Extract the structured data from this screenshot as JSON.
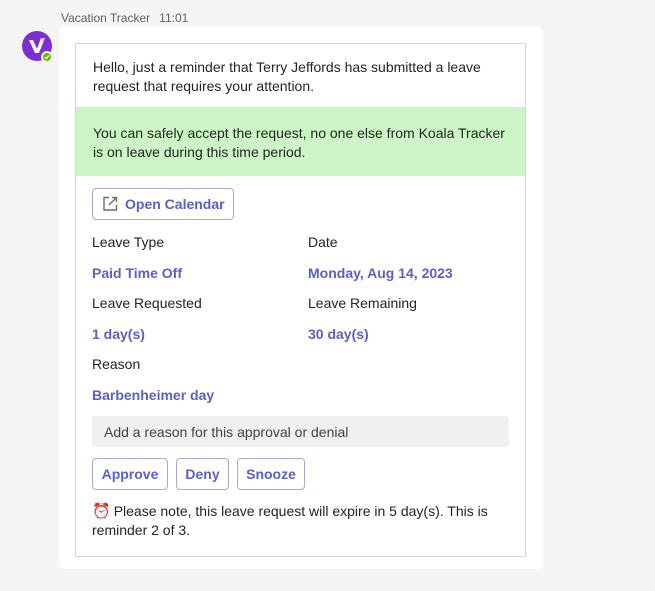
{
  "message": {
    "sender": "Vacation Tracker",
    "time": "11:01"
  },
  "card": {
    "intro": "Hello, just a reminder that Terry Jeffords has submitted a leave request that requires your attention.",
    "banner": "You can safely accept the request, no one else from Koala Tracker is on leave during this time period.",
    "open_calendar_label": "Open Calendar",
    "fields": {
      "leave_type_label": "Leave Type",
      "leave_type_value": "Paid Time Off",
      "date_label": "Date",
      "date_value": "Monday, Aug 14, 2023",
      "leave_requested_label": "Leave Requested",
      "leave_requested_value": "1 day(s)",
      "leave_remaining_label": "Leave Remaining",
      "leave_remaining_value": "30 day(s)",
      "reason_label": "Reason",
      "reason_value": "Barbenheimer day"
    },
    "reason_input_placeholder": "Add a reason for this approval or denial",
    "actions": {
      "approve": "Approve",
      "deny": "Deny",
      "snooze": "Snooze"
    },
    "note_icon": "⏰",
    "note": "Please note, this leave request will expire in 5 day(s). This is reminder 2 of 3."
  },
  "colors": {
    "accent": "#5b5fc7",
    "banner_bg": "#ccf6c6",
    "avatar_bg": "#7b2fd0",
    "presence": "#6bb700"
  }
}
